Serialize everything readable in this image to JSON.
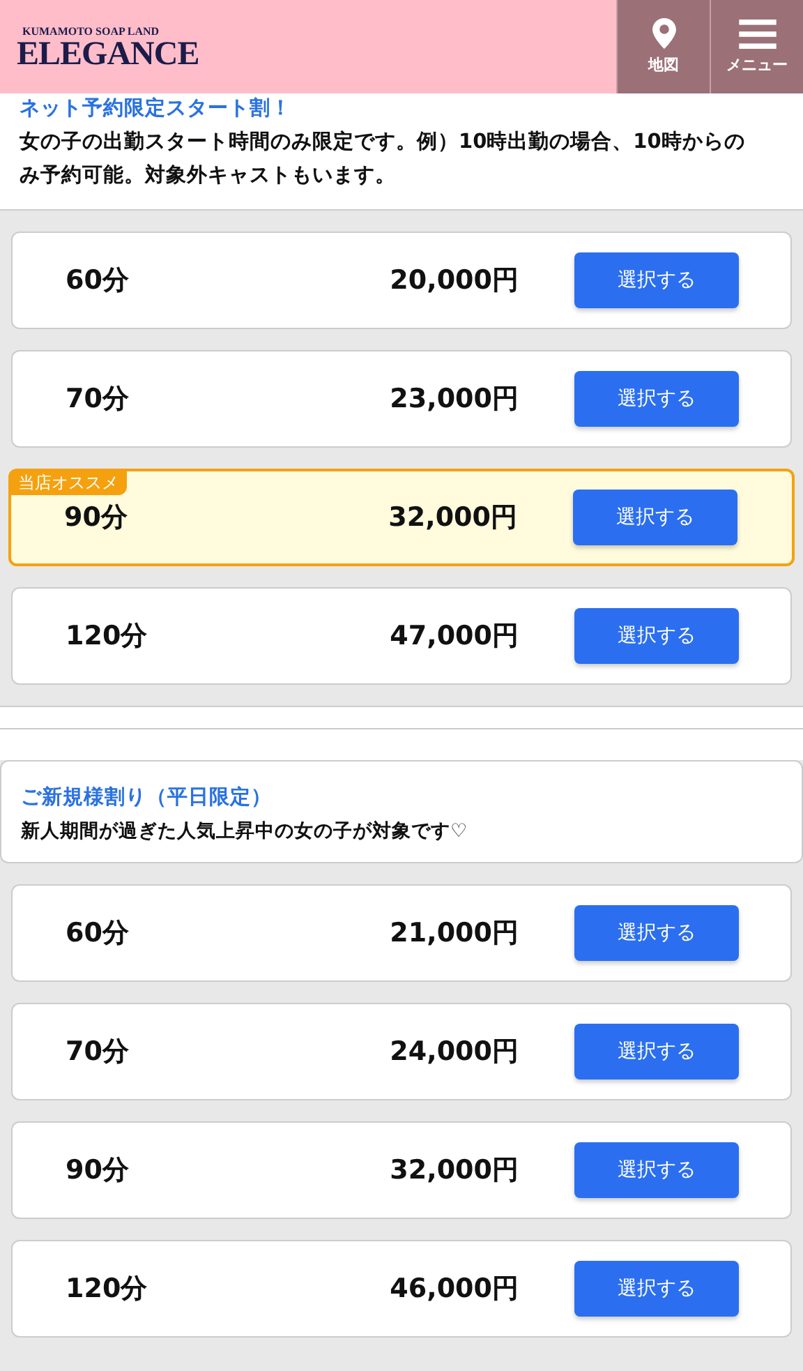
{
  "header": {
    "logo_small": "KUMAMOTO SOAP LAND",
    "logo": "ELEGANCE",
    "nav": [
      {
        "kind": "map",
        "label": "地図"
      },
      {
        "kind": "menu",
        "label": "メニュー"
      }
    ]
  },
  "plans": [
    {
      "title": "ネット予約限定スタート割！",
      "description": "女の子の出勤スタート時間のみ限定です。例）10時出勤の場合、10時からのみ予約可能。対象外キャストもいます。",
      "options": [
        {
          "duration": "60分",
          "price": "20,000円",
          "button": "選択する",
          "recommended": false
        },
        {
          "duration": "70分",
          "price": "23,000円",
          "button": "選択する",
          "recommended": false
        },
        {
          "duration": "90分",
          "price": "32,000円",
          "button": "選択する",
          "recommended": true,
          "badge": "当店オススメ"
        },
        {
          "duration": "120分",
          "price": "47,000円",
          "button": "選択する",
          "recommended": false
        }
      ]
    },
    {
      "title": "ご新規様割り（平日限定）",
      "description": "新人期間が過ぎた人気上昇中の女の子が対象です♡",
      "options": [
        {
          "duration": "60分",
          "price": "21,000円",
          "button": "選択する",
          "recommended": false
        },
        {
          "duration": "70分",
          "price": "24,000円",
          "button": "選択する",
          "recommended": false
        },
        {
          "duration": "90分",
          "price": "32,000円",
          "button": "選択する",
          "recommended": false
        },
        {
          "duration": "120分",
          "price": "46,000円",
          "button": "選択する",
          "recommended": false
        }
      ]
    }
  ]
}
